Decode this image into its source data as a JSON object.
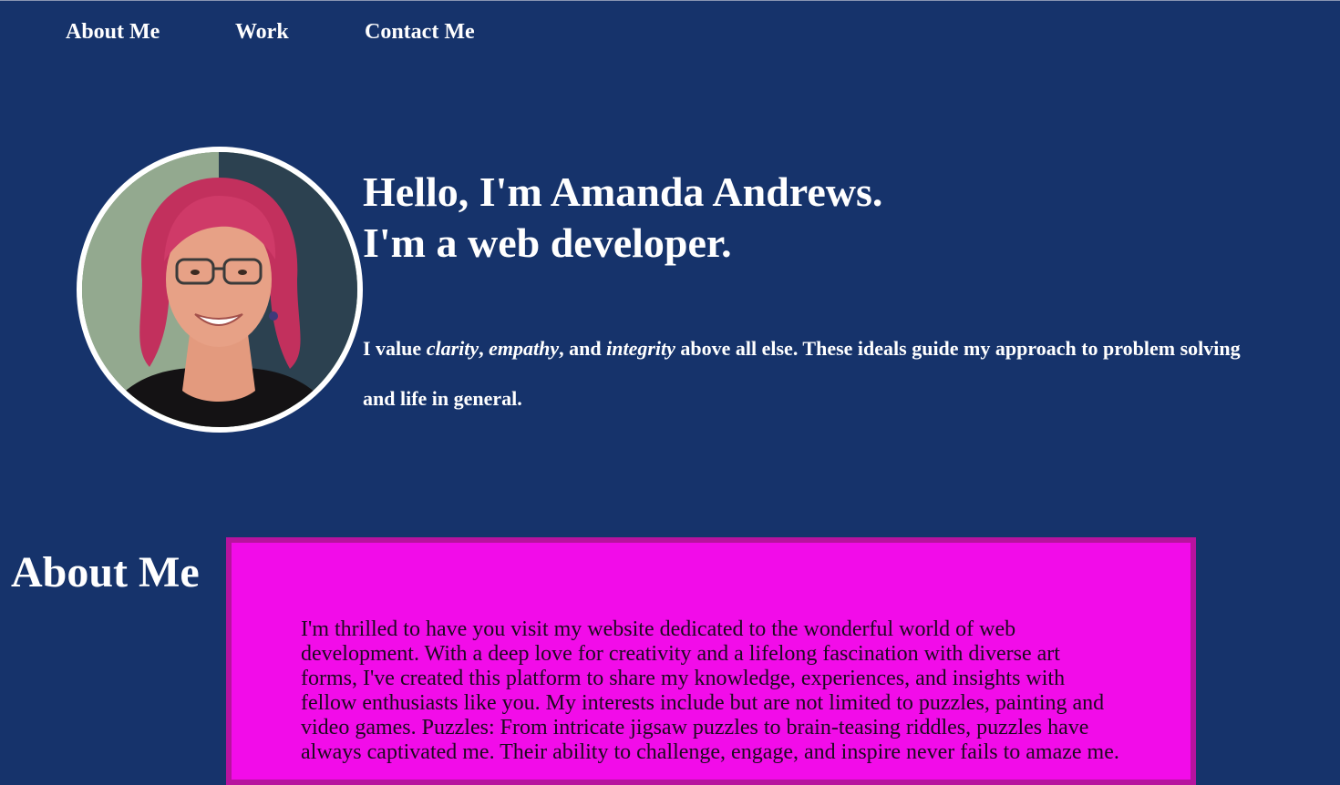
{
  "nav": {
    "items": [
      {
        "label": "About Me"
      },
      {
        "label": "Work"
      },
      {
        "label": "Contact Me"
      }
    ]
  },
  "hero": {
    "avatar_icon": "profile-photo",
    "headline_line1": "Hello, I'm Amanda Andrews.",
    "headline_line2": "I'm a web developer.",
    "intro": {
      "part1": "I value ",
      "em1": "clarity",
      "part2": ", ",
      "em2": "empathy",
      "part3": ", and ",
      "em3": "integrity",
      "part4": " above all else. These ideals guide my approach to problem solving and life in general."
    }
  },
  "about": {
    "heading": "About Me",
    "body": "I'm thrilled to have you visit my website dedicated to the wonderful world of web development. With a deep love for creativity and a lifelong fascination with diverse art forms, I've created this platform to share my knowledge, experiences, and insights with fellow enthusiasts like you. My interests include but are not limited to puzzles, painting and video games. Puzzles: From intricate jigsaw puzzles to brain-teasing riddles, puzzles have always captivated me. Their ability to challenge, engage, and inspire never fails to amaze me."
  },
  "colors": {
    "background": "#16336b",
    "card_background": "#f20ce9",
    "card_border": "#b7139e",
    "text": "#ffffff"
  }
}
